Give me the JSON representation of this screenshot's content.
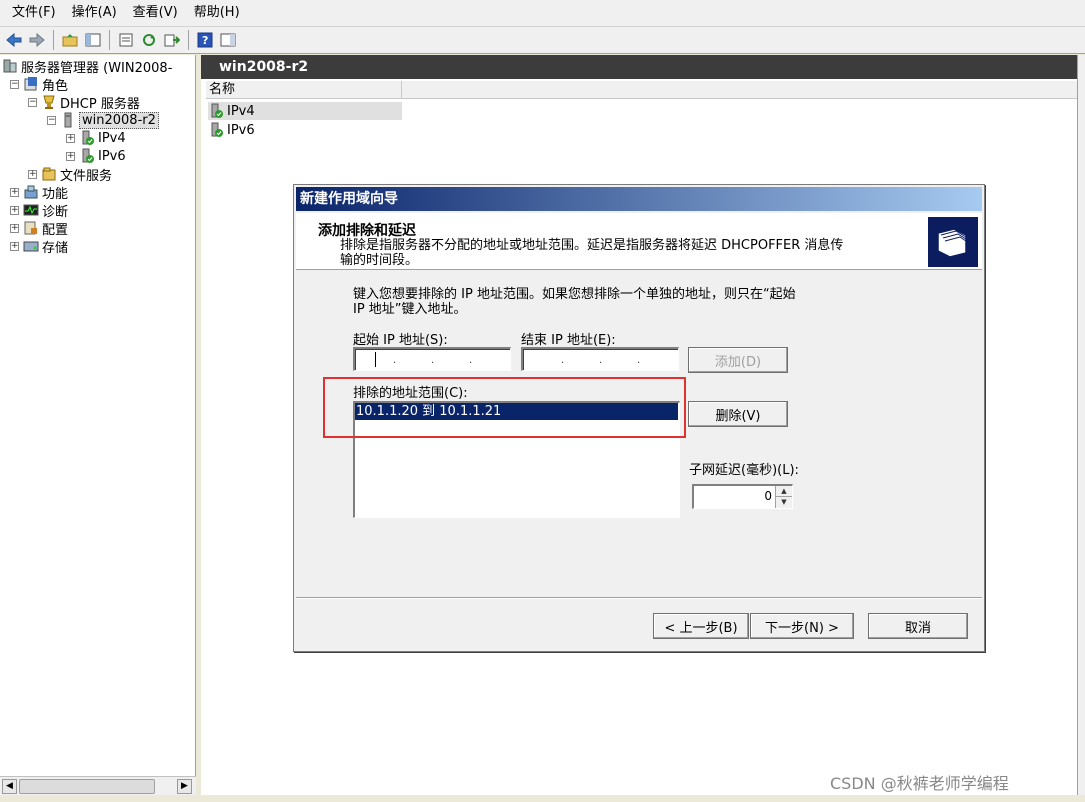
{
  "menu": [
    "文件(F)",
    "操作(A)",
    "查看(V)",
    "帮助(H)"
  ],
  "tree": {
    "root": "服务器管理器 (WIN2008-",
    "roles": "角色",
    "dhcp": "DHCP 服务器",
    "server": "win2008-r2",
    "ipv4": "IPv4",
    "ipv6": "IPv6",
    "file_services": "文件服务",
    "features": "功能",
    "diagnostics": "诊断",
    "configuration": "配置",
    "storage": "存储"
  },
  "content": {
    "header": "win2008-r2",
    "column_name": "名称",
    "items": [
      "IPv4",
      "IPv6"
    ]
  },
  "dialog": {
    "title": "新建作用域向导",
    "heading": "添加排除和延迟",
    "description_line1": "排除是指服务器不分配的地址或地址范围。延迟是指服务器将延迟 DHCPOFFER 消息传",
    "description_line2": "输的时间段。",
    "instruction_line1": "键入您想要排除的 IP 地址范围。如果您想排除一个单独的地址，则只在“起始",
    "instruction_line2": "IP 地址”键入地址。",
    "start_ip_label": "起始 IP 地址(S):",
    "end_ip_label": "结束 IP 地址(E):",
    "add_button": "添加(D)",
    "excluded_label": "排除的地址范围(C):",
    "excluded_items": [
      "10.1.1.20 到 10.1.1.21"
    ],
    "delete_button": "删除(V)",
    "delay_label": "子网延迟(毫秒)(L):",
    "delay_value": "0",
    "back_button": "< 上一步(B)",
    "next_button": "下一步(N) >",
    "cancel_button": "取消"
  },
  "watermark": "CSDN @秋裤老师学编程",
  "colors": {
    "title_gradient_start": "#0a246a",
    "selection": "#0a246a",
    "highlight_border": "#e03030",
    "content_header": "#3c3c3c"
  }
}
